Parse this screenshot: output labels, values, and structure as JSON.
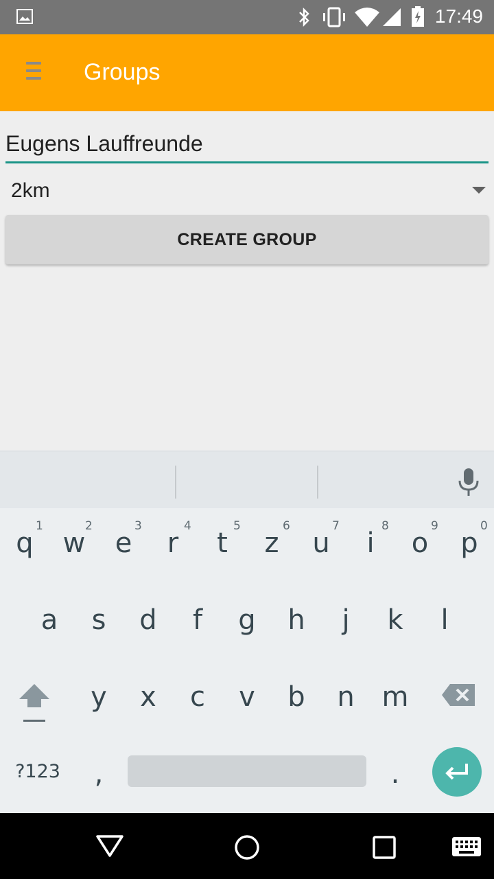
{
  "status_bar": {
    "time": "17:49",
    "icons": [
      "image-icon",
      "bluetooth-icon",
      "vibrate-icon",
      "wifi-icon",
      "signal-icon",
      "battery-icon"
    ]
  },
  "app_bar": {
    "title": "Groups",
    "background": "#FFA500"
  },
  "form": {
    "group_name_value": "Eugens Lauffreunde",
    "distance_selected": "2km",
    "create_button_label": "CREATE GROUP",
    "accent": "#1A9487"
  },
  "keyboard": {
    "row1": [
      {
        "key": "q",
        "hint": "1"
      },
      {
        "key": "w",
        "hint": "2"
      },
      {
        "key": "e",
        "hint": "3"
      },
      {
        "key": "r",
        "hint": "4"
      },
      {
        "key": "t",
        "hint": "5"
      },
      {
        "key": "z",
        "hint": "6"
      },
      {
        "key": "u",
        "hint": "7"
      },
      {
        "key": "i",
        "hint": "8"
      },
      {
        "key": "o",
        "hint": "9"
      },
      {
        "key": "p",
        "hint": "0"
      }
    ],
    "row2": [
      "a",
      "s",
      "d",
      "f",
      "g",
      "h",
      "j",
      "k",
      "l"
    ],
    "row3": [
      "y",
      "x",
      "c",
      "v",
      "b",
      "n",
      "m"
    ],
    "symbols_label": "?123",
    "comma": ",",
    "period": ".",
    "enter_color": "#4DB6AC"
  },
  "nav_bar": {
    "buttons": [
      "back-icon",
      "home-icon",
      "recents-icon",
      "keyboard-switch-icon"
    ]
  }
}
